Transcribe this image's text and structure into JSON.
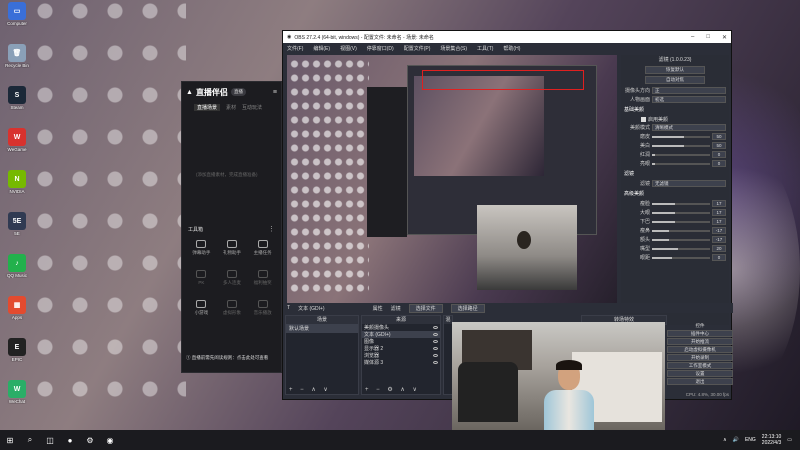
{
  "desktop_icons": [
    {
      "label": "Computer",
      "color": "#3a6fd8",
      "glyph": "▭"
    },
    {
      "label": "Recycle Bin",
      "color": "#8aa0b8",
      "glyph": "🗑"
    },
    {
      "label": "Steam",
      "color": "#1b2838",
      "glyph": "S"
    },
    {
      "label": "WeGame",
      "color": "#d8322e",
      "glyph": "W"
    },
    {
      "label": "NVIDIA",
      "color": "#76b900",
      "glyph": "N"
    },
    {
      "label": "5E",
      "color": "#303a52",
      "glyph": "5E"
    },
    {
      "label": "QQ Music",
      "color": "#22b14c",
      "glyph": "♪"
    },
    {
      "label": "Apps",
      "color": "#e34b2f",
      "glyph": "▦"
    },
    {
      "label": "EPIC",
      "color": "#222222",
      "glyph": "E"
    },
    {
      "label": "WeChat",
      "color": "#2aae67",
      "glyph": "W"
    }
  ],
  "helper": {
    "app_name": "直播伴侣",
    "version": "直播",
    "tabs": [
      "直播场景",
      "素材",
      "互动玩法"
    ],
    "empty_text": "(添加直播素材，完成直播准备)",
    "tools_title": "工具箱",
    "tools": [
      {
        "label": "弹幕助手",
        "dim": false
      },
      {
        "label": "礼物助手",
        "dim": false
      },
      {
        "label": "主播任务",
        "dim": false
      },
      {
        "label": "PK",
        "dim": true
      },
      {
        "label": "多人连麦",
        "dim": true
      },
      {
        "label": "福利抽奖",
        "dim": true
      },
      {
        "label": "小游戏",
        "dim": false
      },
      {
        "label": "虚拟形象",
        "dim": true
      },
      {
        "label": "音乐播放",
        "dim": true
      }
    ],
    "notice": "① 直播前需先阅读规则：点击此处可查看"
  },
  "obs": {
    "title": "OBS 27.2.4 (64-bit, windows) - 配置文件: 未命名 - 场景: 未命名",
    "menus": [
      "文件(F)",
      "编辑(E)",
      "视图(V)",
      "停靠窗口(D)",
      "配置文件(P)",
      "场景集合(S)",
      "工具(T)",
      "帮助(H)"
    ],
    "props": {
      "title": "滤镜 (1.0.0.23)",
      "buttons": [
        "恢复默认",
        "自动对焦"
      ],
      "rows": [
        {
          "k": "摄像头方向",
          "v": "正"
        },
        {
          "k": "人物画面",
          "v": "初选"
        }
      ],
      "beauty_title": "基础美颜",
      "beauty_toggle": "启用美颜",
      "beauty_mode": {
        "k": "美颜模式",
        "v": "清晰模式"
      },
      "beauty_sliders": [
        {
          "k": "磨皮",
          "v": 50,
          "pct": 0.55
        },
        {
          "k": "美白",
          "v": 50,
          "pct": 0.55
        },
        {
          "k": "红润",
          "v": 0,
          "pct": 0.05
        },
        {
          "k": "亮眼",
          "v": 0,
          "pct": 0.05
        }
      ],
      "filter_title": "滤镜",
      "filter_select": {
        "k": "滤镜",
        "v": "无滤镜"
      },
      "shape_title": "高级美颜",
      "shape_sliders": [
        {
          "k": "瘦脸",
          "v": 17,
          "pct": 0.4
        },
        {
          "k": "大眼",
          "v": 17,
          "pct": 0.4
        },
        {
          "k": "下巴",
          "v": 17,
          "pct": 0.4
        },
        {
          "k": "瘦鼻",
          "v": -17,
          "pct": 0.3
        },
        {
          "k": "额头",
          "v": -17,
          "pct": 0.3
        },
        {
          "k": "嘴型",
          "v": 20,
          "pct": 0.45
        },
        {
          "k": "眼距",
          "v": 0,
          "pct": 0.35
        }
      ]
    },
    "srcbar": {
      "source_name": "文本 (GDI+)",
      "properties": "属性",
      "filters": "滤镜",
      "select_file": "选择文件",
      "select_folder": "选择路径"
    },
    "scenes": {
      "header": "场景",
      "items": [
        "默认场景"
      ]
    },
    "sources": {
      "header": "来源",
      "items": [
        "美颜摄像头",
        "文本 (GDI+)",
        "图像",
        "显示器 2",
        "浏览器",
        "媒体源 3"
      ]
    },
    "mixer": {
      "header": "混音器"
    },
    "transitions": {
      "header": "转场特效"
    },
    "controls": {
      "header": "控件",
      "buttons": [
        "插件中心",
        "开始推流",
        "启动虚拟摄像机",
        "开始录制",
        "工作室模式",
        "设置",
        "退出"
      ]
    },
    "status": "CPU: 4.8%, 30.00 fps"
  },
  "taskbar": {
    "items": [
      "⊞",
      "⌕",
      "◫",
      "●",
      "⚙",
      "◉"
    ],
    "lang": "ENG",
    "time": "22:13:10",
    "date": "2022/4/3"
  }
}
